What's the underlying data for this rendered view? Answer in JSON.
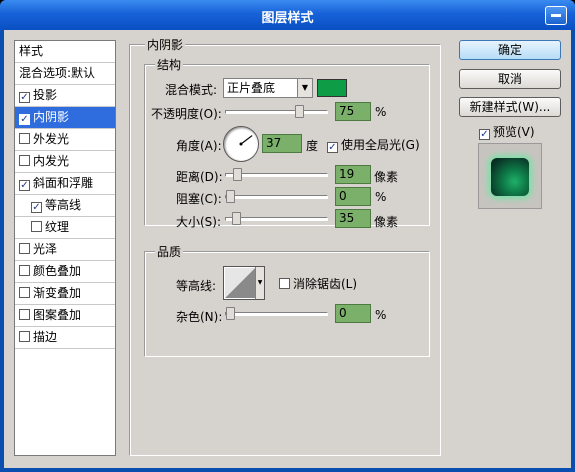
{
  "window": {
    "title": "图层样式"
  },
  "stylelist": {
    "header": "样式",
    "blend_options": "混合选项:默认",
    "items": [
      {
        "label": "投影",
        "checked": true
      },
      {
        "label": "内阴影",
        "checked": true,
        "selected": true
      },
      {
        "label": "外发光",
        "checked": false
      },
      {
        "label": "内发光",
        "checked": false
      },
      {
        "label": "斜面和浮雕",
        "checked": true
      },
      {
        "label": "等高线",
        "checked": true,
        "indent": true
      },
      {
        "label": "纹理",
        "checked": false,
        "indent": true
      },
      {
        "label": "光泽",
        "checked": false
      },
      {
        "label": "颜色叠加",
        "checked": false
      },
      {
        "label": "渐变叠加",
        "checked": false
      },
      {
        "label": "图案叠加",
        "checked": false
      },
      {
        "label": "描边",
        "checked": false
      }
    ]
  },
  "inner_shadow": {
    "section_title": "内阴影",
    "structure": {
      "title": "结构",
      "blend_mode_label": "混合模式:",
      "blend_mode_value": "正片叠底",
      "shadow_color": "#0f9c46",
      "opacity_label": "不透明度(O):",
      "opacity_value": "75",
      "opacity_unit": "%",
      "opacity_pct": 75,
      "angle_label": "角度(A):",
      "angle_value": "37",
      "angle_unit": "度",
      "global_light_label": "使用全局光(G)",
      "global_light_checked": true,
      "distance_label": "距离(D):",
      "distance_value": "19",
      "distance_unit": "像素",
      "distance_pct": 8,
      "choke_label": "阻塞(C):",
      "choke_value": "0",
      "choke_unit": "%",
      "choke_pct": 0,
      "size_label": "大小(S):",
      "size_value": "35",
      "size_unit": "像素",
      "size_pct": 7
    },
    "quality": {
      "title": "品质",
      "contour_label": "等高线:",
      "antialias_label": "消除锯齿(L)",
      "antialias_checked": false,
      "noise_label": "杂色(N):",
      "noise_value": "0",
      "noise_unit": "%",
      "noise_pct": 0
    }
  },
  "buttons": {
    "ok": "确定",
    "cancel": "取消",
    "new_style": "新建样式(W)...",
    "preview_label": "预览(V)",
    "preview_checked": true
  }
}
